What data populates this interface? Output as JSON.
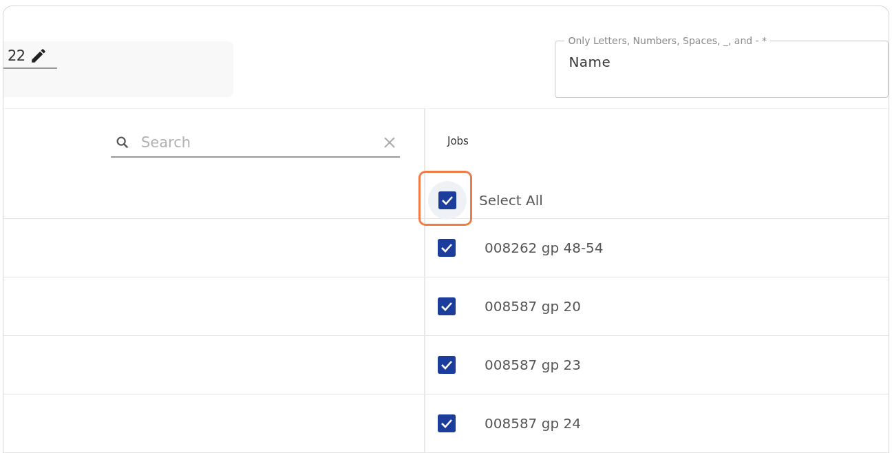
{
  "date_field": {
    "value": "22"
  },
  "name_field": {
    "label": "Only Letters, Numbers, Spaces, _, and - *",
    "value": "Name"
  },
  "search": {
    "placeholder": "Search"
  },
  "jobs": {
    "heading": "Jobs",
    "select_all": {
      "label": "Select All",
      "checked": true,
      "highlighted": true
    },
    "items": [
      {
        "label": "008262 gp 48-54",
        "checked": true
      },
      {
        "label": "008587 gp 20",
        "checked": true
      },
      {
        "label": "008587 gp 23",
        "checked": true
      },
      {
        "label": "008587 gp 24",
        "checked": true
      }
    ]
  }
}
